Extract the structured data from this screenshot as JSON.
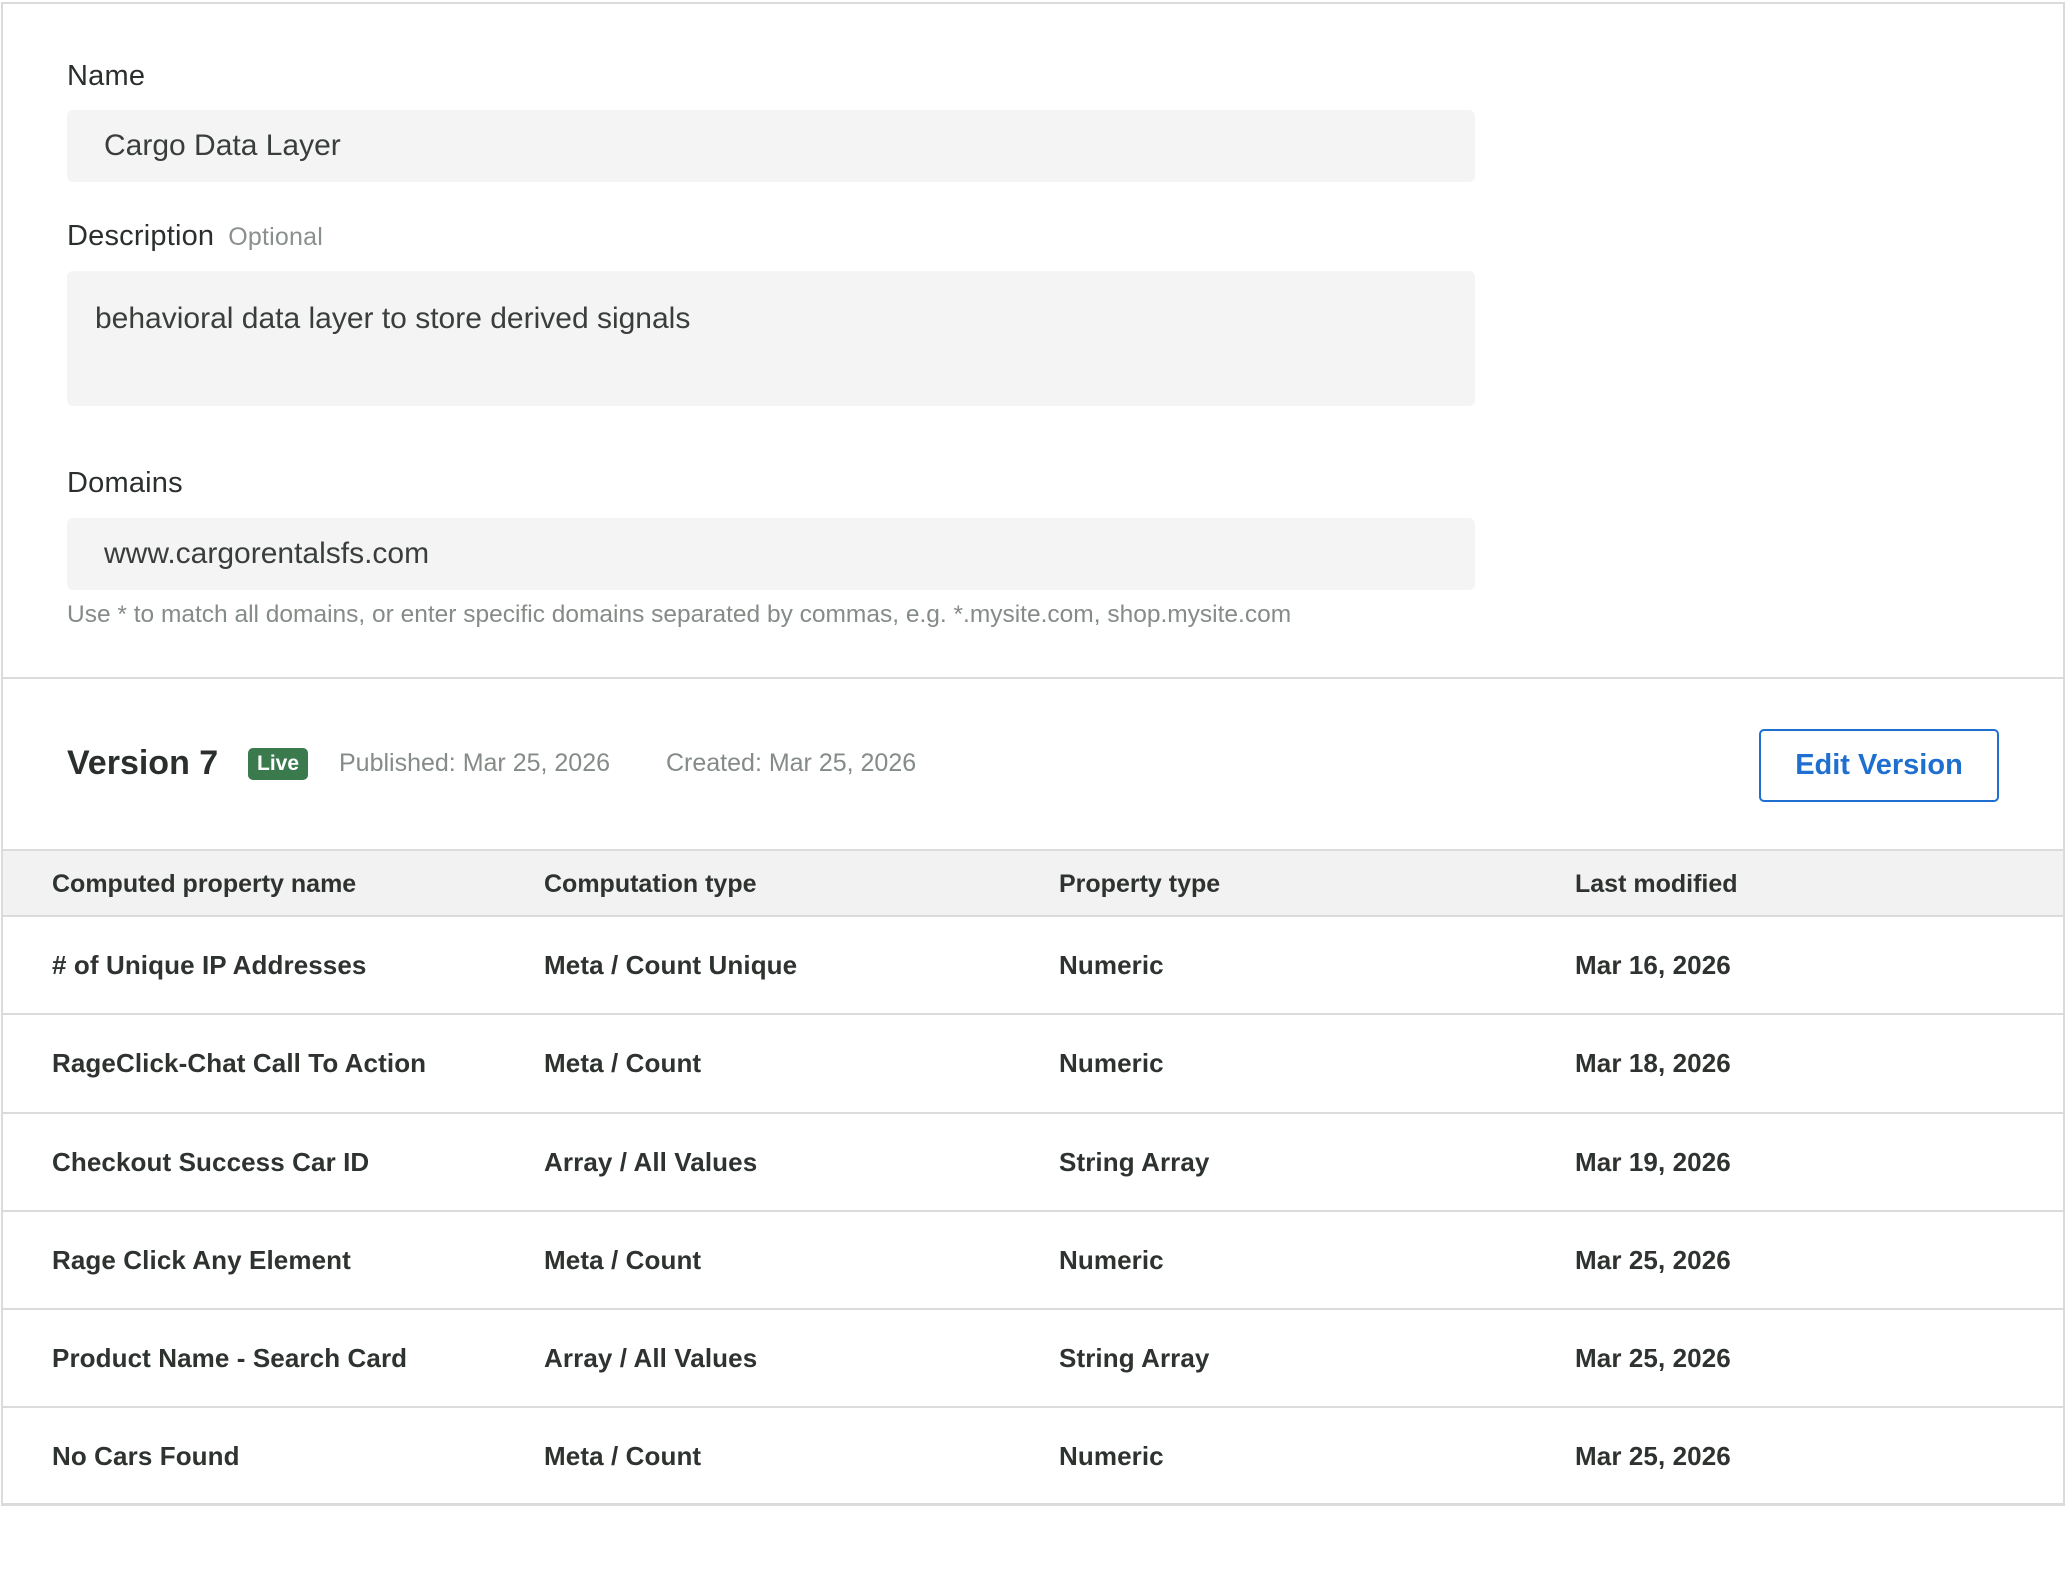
{
  "form": {
    "name_label": "Name",
    "name_value": "Cargo Data Layer",
    "description_label": "Description",
    "description_optional": "Optional",
    "description_value": "behavioral data layer to store derived signals",
    "domains_label": "Domains",
    "domains_value": "www.cargorentalsfs.com",
    "domains_help": "Use * to match all domains, or enter specific domains separated by commas, e.g. *.mysite.com, shop.mysite.com"
  },
  "version": {
    "title": "Version 7",
    "badge": "Live",
    "badge_color": "#3a7a4d",
    "published": "Published: Mar 25, 2026",
    "created": "Created: Mar 25, 2026",
    "edit_button": "Edit Version",
    "accent_color": "#1f6fd1"
  },
  "table": {
    "headers": [
      "Computed property name",
      "Computation type",
      "Property type",
      "Last modified"
    ],
    "rows": [
      {
        "name": "# of Unique IP Addresses",
        "computation": "Meta / Count Unique",
        "type": "Numeric",
        "modified": "Mar 16, 2026"
      },
      {
        "name": "RageClick-Chat Call To Action",
        "computation": "Meta / Count",
        "type": "Numeric",
        "modified": "Mar 18, 2026"
      },
      {
        "name": "Checkout Success Car ID",
        "computation": "Array / All Values",
        "type": "String Array",
        "modified": "Mar 19, 2026"
      },
      {
        "name": "Rage Click Any Element",
        "computation": "Meta / Count",
        "type": "Numeric",
        "modified": "Mar 25, 2026"
      },
      {
        "name": "Product Name - Search Card",
        "computation": "Array / All Values",
        "type": "String Array",
        "modified": "Mar 25, 2026"
      },
      {
        "name": "No Cars Found",
        "computation": "Meta / Count",
        "type": "Numeric",
        "modified": "Mar 25, 2026"
      }
    ]
  }
}
